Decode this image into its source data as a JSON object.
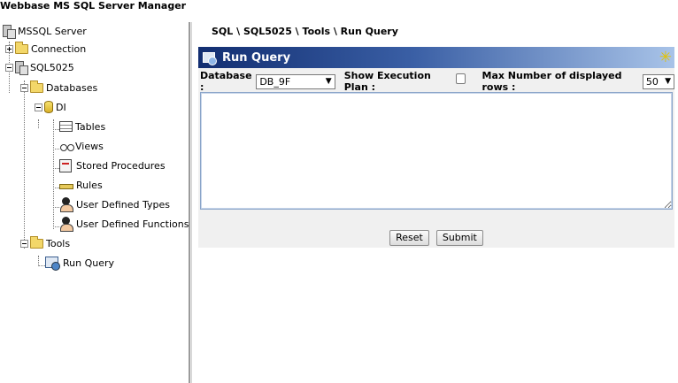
{
  "app": {
    "title": "Webbase MS SQL Server Manager"
  },
  "tree": {
    "root": "MSSQL Server",
    "connection": "Connection",
    "server": "SQL5025",
    "databases": "Databases",
    "db": "DI",
    "tables": "Tables",
    "views": "Views",
    "stored_procedures": "Stored Procedures",
    "rules": "Rules",
    "user_defined_types": "User Defined Types",
    "user_defined_functions": "User Defined Functions",
    "tools": "Tools",
    "run_query": "Run Query"
  },
  "breadcrumb": "SQL \\ SQL5025 \\ Tools \\ Run Query",
  "panel": {
    "title": "Run Query",
    "database_label": "Database :",
    "database_value": "DB_9F",
    "exec_plan_label": "Show Execution Plan :",
    "max_rows_label": "Max Number of displayed rows :",
    "max_rows_value": "50",
    "query_text": "",
    "reset_label": "Reset",
    "submit_label": "Submit"
  }
}
